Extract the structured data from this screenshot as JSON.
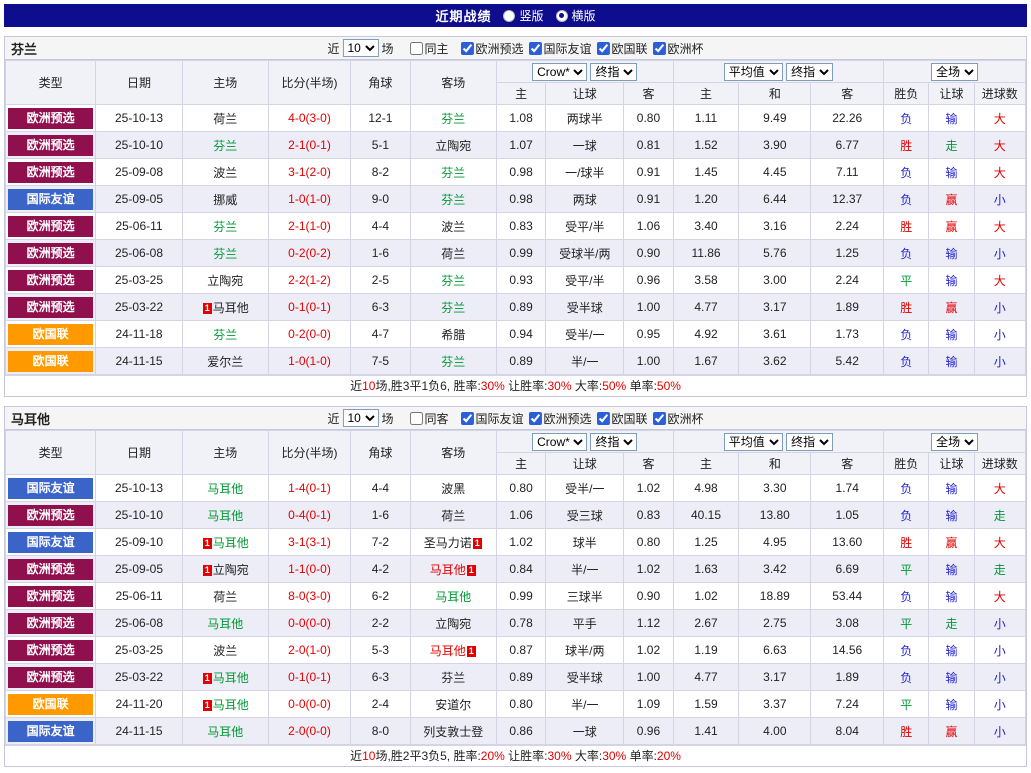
{
  "topbar": {
    "title": "近期战绩",
    "radios": [
      {
        "label": "竖版",
        "checked": false
      },
      {
        "label": "横版",
        "checked": true
      }
    ]
  },
  "columns": {
    "type": "类型",
    "date": "日期",
    "home": "主场",
    "score": "比分(半场)",
    "corner": "角球",
    "away": "客场",
    "odds_group": {
      "select1": "Crow*",
      "select2": "终指",
      "sub": [
        "主",
        "让球",
        "客"
      ]
    },
    "avg_group": {
      "select1": "平均值",
      "select2": "终指",
      "sub": [
        "主",
        "和",
        "客"
      ]
    },
    "result_group": {
      "select1": "全场",
      "sub": [
        "胜负",
        "让球",
        "进球数"
      ]
    }
  },
  "colors": {
    "badge": {
      "purple": "#90104e",
      "blue": "#3a64c8",
      "orange": "#ff9900"
    },
    "team": {
      "green": "#009933",
      "red": "#e30000",
      "black": "#222222"
    },
    "result": {
      "red": "#e30000",
      "green": "#009933",
      "blue": "#2424cc"
    }
  },
  "misc": {
    "red_card": "1"
  },
  "sections": [
    {
      "team": "芬兰",
      "filter": {
        "near": "近",
        "count": "10",
        "games": "场",
        "same": {
          "label": "同主",
          "checked": false
        },
        "leagues": [
          {
            "label": "欧洲预选",
            "checked": true
          },
          {
            "label": "国际友谊",
            "checked": true
          },
          {
            "label": "欧国联",
            "checked": true
          },
          {
            "label": "欧洲杯",
            "checked": true
          }
        ]
      },
      "rows": [
        {
          "type": "欧洲预选",
          "tc": "purple",
          "date": "25-10-13",
          "home": {
            "n": "荷兰",
            "c": "black"
          },
          "score": "4-0(3-0)",
          "corner": "12-1",
          "away": {
            "n": "芬兰",
            "c": "green"
          },
          "odds": [
            "1.08",
            "两球半",
            "0.80"
          ],
          "avg": [
            "1.11",
            "9.49",
            "22.26"
          ],
          "res": [
            [
              "负",
              "blue"
            ],
            [
              "输",
              "blue"
            ],
            [
              "大",
              "red"
            ]
          ]
        },
        {
          "type": "欧洲预选",
          "tc": "purple",
          "date": "25-10-10",
          "home": {
            "n": "芬兰",
            "c": "green"
          },
          "score": "2-1(0-1)",
          "corner": "5-1",
          "away": {
            "n": "立陶宛",
            "c": "black"
          },
          "odds": [
            "1.07",
            "一球",
            "0.81"
          ],
          "avg": [
            "1.52",
            "3.90",
            "6.77"
          ],
          "res": [
            [
              "胜",
              "red"
            ],
            [
              "走",
              "green"
            ],
            [
              "大",
              "red"
            ]
          ]
        },
        {
          "type": "欧洲预选",
          "tc": "purple",
          "date": "25-09-08",
          "home": {
            "n": "波兰",
            "c": "black"
          },
          "score": "3-1(2-0)",
          "corner": "8-2",
          "away": {
            "n": "芬兰",
            "c": "green"
          },
          "odds": [
            "0.98",
            "一/球半",
            "0.91"
          ],
          "avg": [
            "1.45",
            "4.45",
            "7.11"
          ],
          "res": [
            [
              "负",
              "blue"
            ],
            [
              "输",
              "blue"
            ],
            [
              "大",
              "red"
            ]
          ]
        },
        {
          "type": "国际友谊",
          "tc": "blue",
          "date": "25-09-05",
          "home": {
            "n": "挪威",
            "c": "black"
          },
          "score": "1-0(1-0)",
          "corner": "9-0",
          "away": {
            "n": "芬兰",
            "c": "green"
          },
          "odds": [
            "0.98",
            "两球",
            "0.91"
          ],
          "avg": [
            "1.20",
            "6.44",
            "12.37"
          ],
          "res": [
            [
              "负",
              "blue"
            ],
            [
              "赢",
              "red"
            ],
            [
              "小",
              "blue"
            ]
          ]
        },
        {
          "type": "欧洲预选",
          "tc": "purple",
          "date": "25-06-11",
          "home": {
            "n": "芬兰",
            "c": "green"
          },
          "score": "2-1(1-0)",
          "corner": "4-4",
          "away": {
            "n": "波兰",
            "c": "black"
          },
          "odds": [
            "0.83",
            "受平/半",
            "1.06"
          ],
          "avg": [
            "3.40",
            "3.16",
            "2.24"
          ],
          "res": [
            [
              "胜",
              "red"
            ],
            [
              "赢",
              "red"
            ],
            [
              "大",
              "red"
            ]
          ]
        },
        {
          "type": "欧洲预选",
          "tc": "purple",
          "date": "25-06-08",
          "home": {
            "n": "芬兰",
            "c": "green"
          },
          "score": "0-2(0-2)",
          "corner": "1-6",
          "away": {
            "n": "荷兰",
            "c": "black"
          },
          "odds": [
            "0.99",
            "受球半/两",
            "0.90"
          ],
          "avg": [
            "11.86",
            "5.76",
            "1.25"
          ],
          "res": [
            [
              "负",
              "blue"
            ],
            [
              "输",
              "blue"
            ],
            [
              "小",
              "blue"
            ]
          ]
        },
        {
          "type": "欧洲预选",
          "tc": "purple",
          "date": "25-03-25",
          "home": {
            "n": "立陶宛",
            "c": "black"
          },
          "score": "2-2(1-2)",
          "corner": "2-5",
          "away": {
            "n": "芬兰",
            "c": "green"
          },
          "odds": [
            "0.93",
            "受平/半",
            "0.96"
          ],
          "avg": [
            "3.58",
            "3.00",
            "2.24"
          ],
          "res": [
            [
              "平",
              "green"
            ],
            [
              "输",
              "blue"
            ],
            [
              "大",
              "red"
            ]
          ]
        },
        {
          "type": "欧洲预选",
          "tc": "purple",
          "date": "25-03-22",
          "home": {
            "n": "马耳他",
            "c": "black",
            "card": "before"
          },
          "score": "0-1(0-1)",
          "corner": "6-3",
          "away": {
            "n": "芬兰",
            "c": "green"
          },
          "odds": [
            "0.89",
            "受半球",
            "1.00"
          ],
          "avg": [
            "4.77",
            "3.17",
            "1.89"
          ],
          "res": [
            [
              "胜",
              "red"
            ],
            [
              "赢",
              "red"
            ],
            [
              "小",
              "blue"
            ]
          ]
        },
        {
          "type": "欧国联",
          "tc": "orange",
          "date": "24-11-18",
          "home": {
            "n": "芬兰",
            "c": "green"
          },
          "score": "0-2(0-0)",
          "corner": "4-7",
          "away": {
            "n": "希腊",
            "c": "black"
          },
          "odds": [
            "0.94",
            "受半/一",
            "0.95"
          ],
          "avg": [
            "4.92",
            "3.61",
            "1.73"
          ],
          "res": [
            [
              "负",
              "blue"
            ],
            [
              "输",
              "blue"
            ],
            [
              "小",
              "blue"
            ]
          ]
        },
        {
          "type": "欧国联",
          "tc": "orange",
          "date": "24-11-15",
          "home": {
            "n": "爱尔兰",
            "c": "black"
          },
          "score": "1-0(1-0)",
          "corner": "7-5",
          "away": {
            "n": "芬兰",
            "c": "green"
          },
          "odds": [
            "0.89",
            "半/一",
            "1.00"
          ],
          "avg": [
            "1.67",
            "3.62",
            "5.42"
          ],
          "res": [
            [
              "负",
              "blue"
            ],
            [
              "输",
              "blue"
            ],
            [
              "小",
              "blue"
            ]
          ]
        }
      ],
      "summary": {
        "pre": "近",
        "count": "10",
        "mid": "场,胜3平1负6, 胜率:",
        "win": "30%",
        "l1": " 让胜率:",
        "hcp": "30%",
        "l2": " 大率:",
        "big": "50%",
        "l3": " 单率:",
        "single": "50%"
      }
    },
    {
      "team": "马耳他",
      "filter": {
        "near": "近",
        "count": "10",
        "games": "场",
        "same": {
          "label": "同客",
          "checked": false
        },
        "leagues": [
          {
            "label": "国际友谊",
            "checked": true
          },
          {
            "label": "欧洲预选",
            "checked": true
          },
          {
            "label": "欧国联",
            "checked": true
          },
          {
            "label": "欧洲杯",
            "checked": true
          }
        ]
      },
      "rows": [
        {
          "type": "国际友谊",
          "tc": "blue",
          "date": "25-10-13",
          "home": {
            "n": "马耳他",
            "c": "green"
          },
          "score": "1-4(0-1)",
          "corner": "4-4",
          "away": {
            "n": "波黑",
            "c": "black"
          },
          "odds": [
            "0.80",
            "受半/一",
            "1.02"
          ],
          "avg": [
            "4.98",
            "3.30",
            "1.74"
          ],
          "res": [
            [
              "负",
              "blue"
            ],
            [
              "输",
              "blue"
            ],
            [
              "大",
              "red"
            ]
          ]
        },
        {
          "type": "欧洲预选",
          "tc": "purple",
          "date": "25-10-10",
          "home": {
            "n": "马耳他",
            "c": "green"
          },
          "score": "0-4(0-1)",
          "corner": "1-6",
          "away": {
            "n": "荷兰",
            "c": "black"
          },
          "odds": [
            "1.06",
            "受三球",
            "0.83"
          ],
          "avg": [
            "40.15",
            "13.80",
            "1.05"
          ],
          "res": [
            [
              "负",
              "blue"
            ],
            [
              "输",
              "blue"
            ],
            [
              "走",
              "green"
            ]
          ]
        },
        {
          "type": "国际友谊",
          "tc": "blue",
          "date": "25-09-10",
          "home": {
            "n": "马耳他",
            "c": "green",
            "card": "before"
          },
          "score": "3-1(3-1)",
          "corner": "7-2",
          "away": {
            "n": "圣马力诺",
            "c": "black",
            "card": "after"
          },
          "odds": [
            "1.02",
            "球半",
            "0.80"
          ],
          "avg": [
            "1.25",
            "4.95",
            "13.60"
          ],
          "res": [
            [
              "胜",
              "red"
            ],
            [
              "赢",
              "red"
            ],
            [
              "大",
              "red"
            ]
          ]
        },
        {
          "type": "欧洲预选",
          "tc": "purple",
          "date": "25-09-05",
          "home": {
            "n": "立陶宛",
            "c": "black",
            "card": "before"
          },
          "score": "1-1(0-0)",
          "corner": "4-2",
          "away": {
            "n": "马耳他",
            "c": "red",
            "card": "after"
          },
          "odds": [
            "0.84",
            "半/一",
            "1.02"
          ],
          "avg": [
            "1.63",
            "3.42",
            "6.69"
          ],
          "res": [
            [
              "平",
              "green"
            ],
            [
              "输",
              "blue"
            ],
            [
              "走",
              "green"
            ]
          ]
        },
        {
          "type": "欧洲预选",
          "tc": "purple",
          "date": "25-06-11",
          "home": {
            "n": "荷兰",
            "c": "black"
          },
          "score": "8-0(3-0)",
          "corner": "6-2",
          "away": {
            "n": "马耳他",
            "c": "green"
          },
          "odds": [
            "0.99",
            "三球半",
            "0.90"
          ],
          "avg": [
            "1.02",
            "18.89",
            "53.44"
          ],
          "res": [
            [
              "负",
              "blue"
            ],
            [
              "输",
              "blue"
            ],
            [
              "大",
              "red"
            ]
          ]
        },
        {
          "type": "欧洲预选",
          "tc": "purple",
          "date": "25-06-08",
          "home": {
            "n": "马耳他",
            "c": "green"
          },
          "score": "0-0(0-0)",
          "corner": "2-2",
          "away": {
            "n": "立陶宛",
            "c": "black"
          },
          "odds": [
            "0.78",
            "平手",
            "1.12"
          ],
          "avg": [
            "2.67",
            "2.75",
            "3.08"
          ],
          "res": [
            [
              "平",
              "green"
            ],
            [
              "走",
              "green"
            ],
            [
              "小",
              "blue"
            ]
          ]
        },
        {
          "type": "欧洲预选",
          "tc": "purple",
          "date": "25-03-25",
          "home": {
            "n": "波兰",
            "c": "black"
          },
          "score": "2-0(1-0)",
          "corner": "5-3",
          "away": {
            "n": "马耳他",
            "c": "red",
            "card": "after"
          },
          "odds": [
            "0.87",
            "球半/两",
            "1.02"
          ],
          "avg": [
            "1.19",
            "6.63",
            "14.56"
          ],
          "res": [
            [
              "负",
              "blue"
            ],
            [
              "输",
              "blue"
            ],
            [
              "小",
              "blue"
            ]
          ]
        },
        {
          "type": "欧洲预选",
          "tc": "purple",
          "date": "25-03-22",
          "home": {
            "n": "马耳他",
            "c": "green",
            "card": "before"
          },
          "score": "0-1(0-1)",
          "corner": "6-3",
          "away": {
            "n": "芬兰",
            "c": "black"
          },
          "odds": [
            "0.89",
            "受半球",
            "1.00"
          ],
          "avg": [
            "4.77",
            "3.17",
            "1.89"
          ],
          "res": [
            [
              "负",
              "blue"
            ],
            [
              "输",
              "blue"
            ],
            [
              "小",
              "blue"
            ]
          ]
        },
        {
          "type": "欧国联",
          "tc": "orange",
          "date": "24-11-20",
          "home": {
            "n": "马耳他",
            "c": "green",
            "card": "before"
          },
          "score": "0-0(0-0)",
          "corner": "2-4",
          "away": {
            "n": "安道尔",
            "c": "black"
          },
          "odds": [
            "0.80",
            "半/一",
            "1.09"
          ],
          "avg": [
            "1.59",
            "3.37",
            "7.24"
          ],
          "res": [
            [
              "平",
              "green"
            ],
            [
              "输",
              "blue"
            ],
            [
              "小",
              "blue"
            ]
          ]
        },
        {
          "type": "国际友谊",
          "tc": "blue",
          "date": "24-11-15",
          "home": {
            "n": "马耳他",
            "c": "green"
          },
          "score": "2-0(0-0)",
          "corner": "8-0",
          "away": {
            "n": "列支敦士登",
            "c": "black"
          },
          "odds": [
            "0.86",
            "一球",
            "0.96"
          ],
          "avg": [
            "1.41",
            "4.00",
            "8.04"
          ],
          "res": [
            [
              "胜",
              "red"
            ],
            [
              "赢",
              "red"
            ],
            [
              "小",
              "blue"
            ]
          ]
        }
      ],
      "summary": {
        "pre": "近",
        "count": "10",
        "mid": "场,胜2平3负5, 胜率:",
        "win": "20%",
        "l1": " 让胜率:",
        "hcp": "30%",
        "l2": " 大率:",
        "big": "30%",
        "l3": " 单率:",
        "single": "20%"
      }
    }
  ]
}
